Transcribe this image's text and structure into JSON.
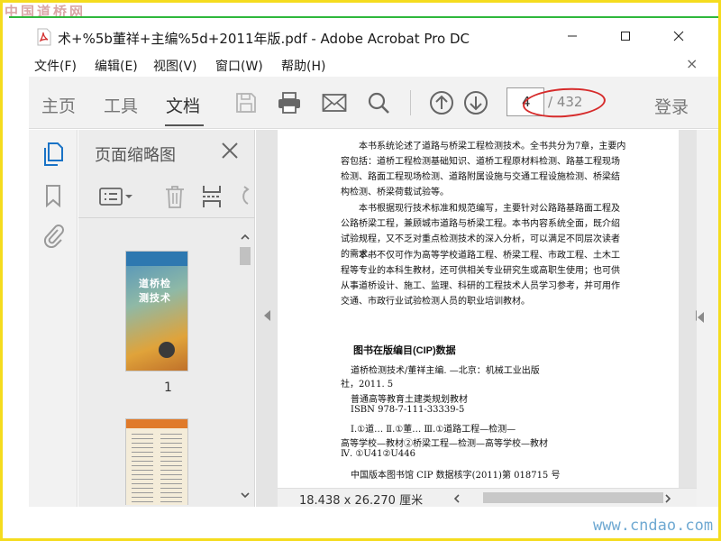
{
  "watermarks": {
    "top": "中国道桥网",
    "bottom": "www.cndao.com"
  },
  "window": {
    "title": "术+%5b董祥+主编%5d+2011年版.pdf - Adobe Acrobat Pro DC",
    "controls": [
      "minimize-icon",
      "maximize-icon",
      "close-icon"
    ]
  },
  "menu": {
    "items": [
      "文件(F)",
      "编辑(E)",
      "视图(V)",
      "窗口(W)",
      "帮助(H)"
    ],
    "close": "×"
  },
  "toolbar": {
    "tabs": [
      {
        "label": "主页",
        "active": false
      },
      {
        "label": "工具",
        "active": false
      },
      {
        "label": "文档",
        "active": true
      }
    ],
    "icons": [
      "save-icon",
      "print-icon",
      "mail-icon",
      "search-icon",
      "page-up-icon",
      "page-down-icon"
    ],
    "page_current": "4",
    "page_total": "/ 432",
    "login": "登录",
    "highlight_color": "#d62b2b"
  },
  "rail": {
    "icons": [
      "page-thumbnails-icon",
      "bookmark-icon",
      "attachment-icon"
    ],
    "accent": "#1a73c6"
  },
  "thumbnails_panel": {
    "title": "页面缩略图",
    "tools": [
      "options-menu-icon",
      "delete-icon",
      "insert-page-icon",
      "rotate-icon"
    ],
    "pages": [
      {
        "number": "1",
        "cover_title": "道桥检测技术"
      },
      {
        "number": "",
        "cover_title": ""
      }
    ]
  },
  "document": {
    "paragraphs": [
      "本书系统论述了道路与桥梁工程检测技术。全书共分为7章，主要内容包括：道桥工程检测基础知识、道桥工程原材料检测、路基工程现场检测、路面工程现场检测、道路附属设施与交通工程设施检测、桥梁结构检测、桥梁荷载试验等。",
      "本书根据现行技术标准和规范编写，主要针对公路路基路面工程及公路桥梁工程，兼顾城市道路与桥梁工程。本书内容系统全面，既介绍试验规程，又不乏对重点检测技术的深入分析，可以满足不同层次读者的需求。",
      "本书不仅可作为高等学校道路工程、桥梁工程、市政工程、土木工程等专业的本科生教材，还可供相关专业研究生或高职生使用；也可供从事道桥设计、施工、监理、科研的工程技术人员学习参考，并可用作交通、市政行业试验检测人员的职业培训教材。"
    ],
    "cip_title": "图书在版编目(CIP)数据",
    "cip_lines": [
      "道桥检测技术/董祥主编. —北京：机械工业出版",
      "社，2011. 5",
      "普通高等教育土建类规划教材",
      "ISBN 978-7-111-33339-5",
      "Ⅰ.①道…  Ⅱ.①董…  Ⅲ.①道路工程—检测—",
      "高等学校—教材②桥梁工程—检测—高等学校—教材",
      "Ⅳ. ①U41②U446",
      "中国版本图书馆 CIP 数据核字(2011)第 018715 号"
    ]
  },
  "status": {
    "dimensions": "18.438 x 26.270 厘米"
  }
}
